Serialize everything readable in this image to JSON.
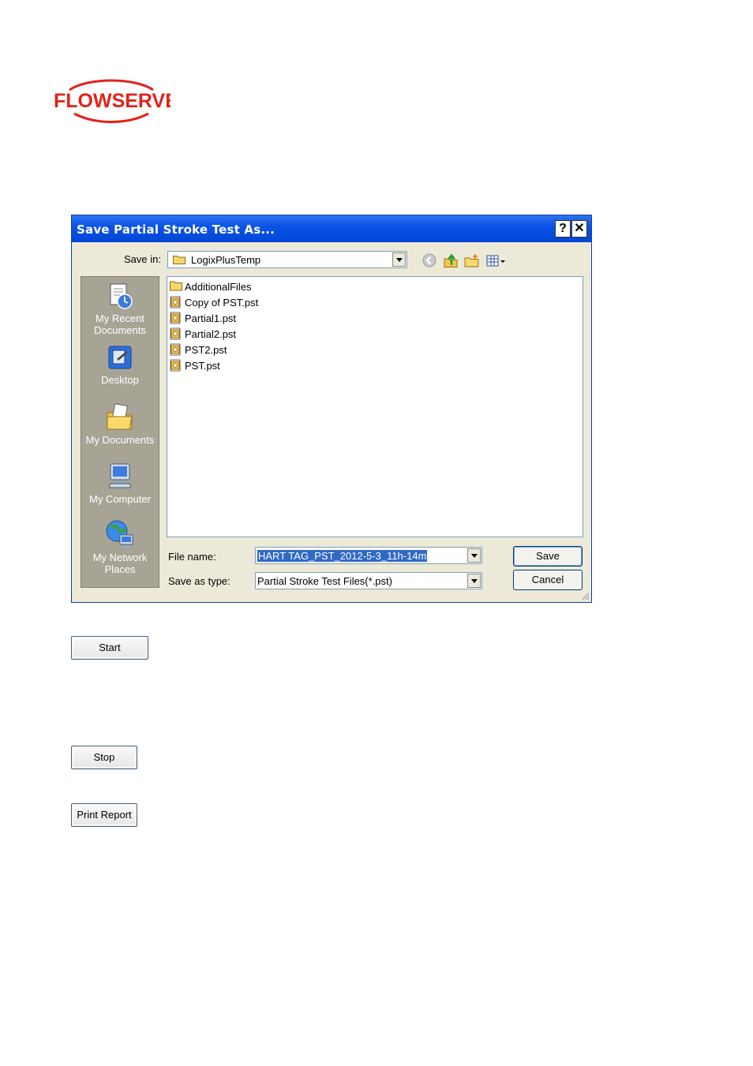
{
  "brand": {
    "name": "FLOWSERVE",
    "color": "#e2231a"
  },
  "dialog": {
    "title": "Save Partial Stroke Test As...",
    "help_label": "?",
    "close_label": "✕",
    "save_in_label": "Save in:",
    "save_in_value": "LogixPlusTemp",
    "places": [
      {
        "label_line1": "My Recent",
        "label_line2": "Documents",
        "icon": "recent-documents-icon"
      },
      {
        "label_line1": "Desktop",
        "label_line2": "",
        "icon": "desktop-icon"
      },
      {
        "label_line1": "My Documents",
        "label_line2": "",
        "icon": "my-documents-icon"
      },
      {
        "label_line1": "My Computer",
        "label_line2": "",
        "icon": "my-computer-icon"
      },
      {
        "label_line1": "My Network",
        "label_line2": "Places",
        "icon": "network-places-icon"
      }
    ],
    "files": [
      {
        "name": "AdditionalFiles",
        "type": "folder"
      },
      {
        "name": "Copy of PST.pst",
        "type": "pst"
      },
      {
        "name": "Partial1.pst",
        "type": "pst"
      },
      {
        "name": "Partial2.pst",
        "type": "pst"
      },
      {
        "name": "PST2.pst",
        "type": "pst"
      },
      {
        "name": "PST.pst",
        "type": "pst"
      }
    ],
    "file_name_label": "File name:",
    "file_name_value": "HART TAG_PST_2012-5-3_11h-14m",
    "save_as_type_label": "Save as type:",
    "save_as_type_value": "Partial Stroke Test Files(*.pst)",
    "save_button": "Save",
    "cancel_button": "Cancel"
  },
  "buttons": {
    "start": "Start",
    "stop": "Stop",
    "print_report": "Print Report"
  }
}
